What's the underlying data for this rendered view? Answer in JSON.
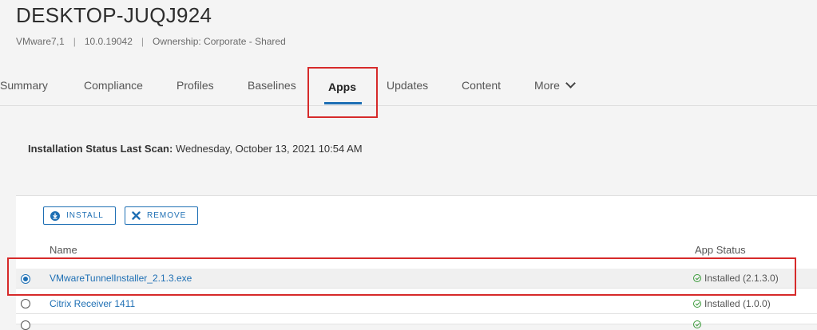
{
  "device": {
    "title": "DESKTOP-JUQJ924",
    "model": "VMware7,1",
    "os_version": "10.0.19042",
    "ownership": "Ownership: Corporate - Shared"
  },
  "tabs": [
    {
      "label": "Summary"
    },
    {
      "label": "Compliance"
    },
    {
      "label": "Profiles"
    },
    {
      "label": "Baselines"
    },
    {
      "label": "Apps",
      "active": true
    },
    {
      "label": "Updates"
    },
    {
      "label": "Content"
    },
    {
      "label": "More"
    }
  ],
  "scan": {
    "label": "Installation Status Last Scan:",
    "value": "Wednesday, October 13, 2021 10:54 AM"
  },
  "toolbar": {
    "install_label": "INSTALL",
    "remove_label": "REMOVE"
  },
  "table": {
    "columns": {
      "name": "Name",
      "status": "App Status"
    },
    "rows": [
      {
        "name": "VMwareTunnelInstaller_2.1.3.exe",
        "status": "Installed (2.1.3.0)",
        "selected": true
      },
      {
        "name": "Citrix Receiver 1411",
        "status": "Installed (1.0.0)",
        "selected": false
      }
    ]
  },
  "colors": {
    "accent": "#1e6fb4",
    "highlight": "#d62a2a",
    "success": "#3a9a3a"
  }
}
